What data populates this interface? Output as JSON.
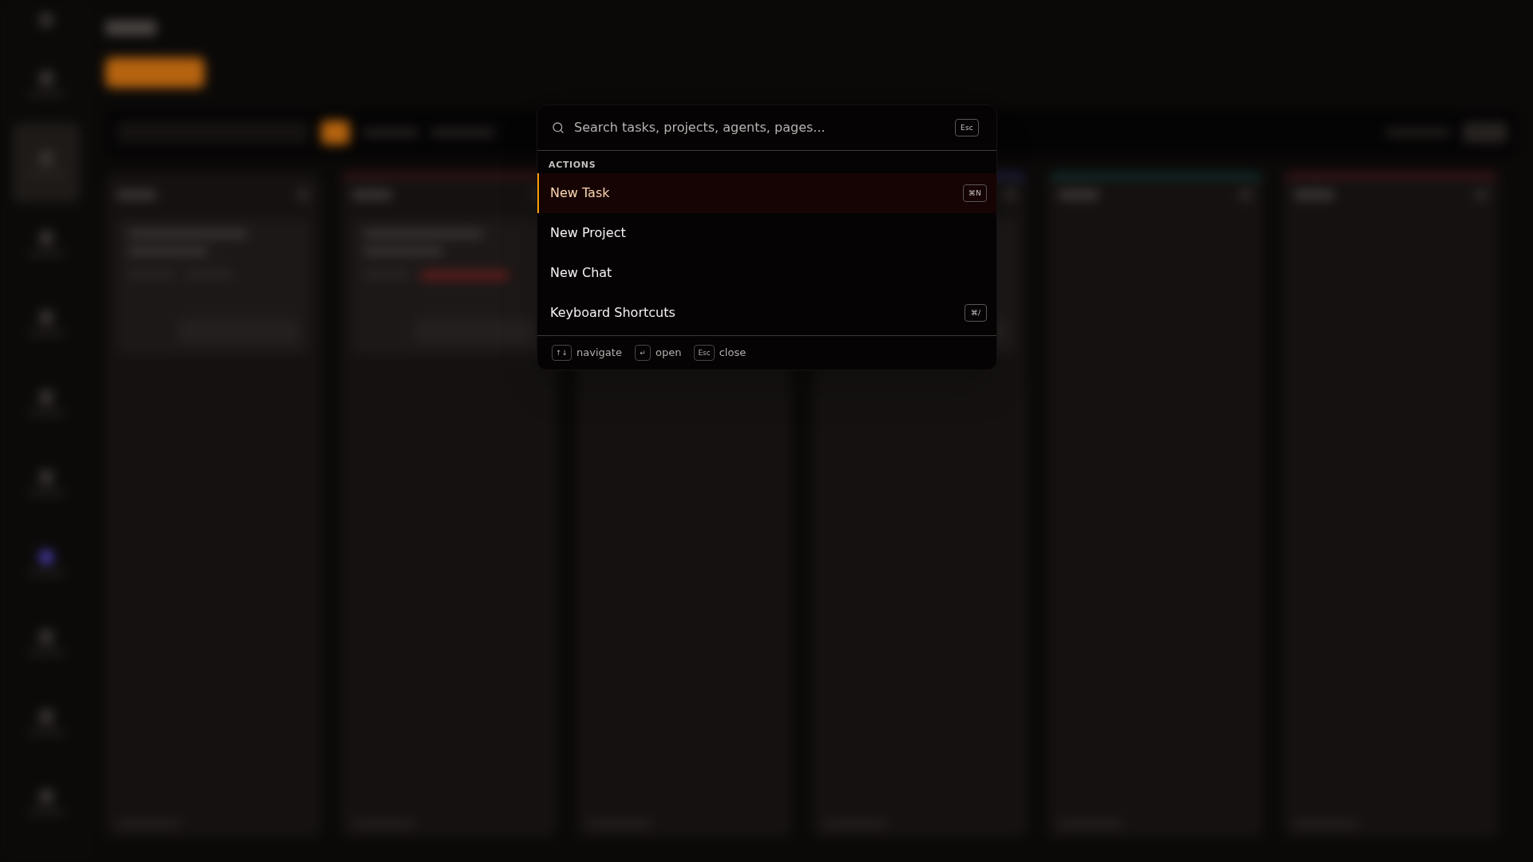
{
  "command_palette": {
    "search": {
      "placeholder": "Search tasks, projects, agents, pages...",
      "shortcut": "Esc"
    },
    "sections": [
      {
        "title": "ACTIONS",
        "items": [
          {
            "label": "New Task",
            "shortcut": "⌘N",
            "selected": true
          },
          {
            "label": "New Project",
            "selected": false
          },
          {
            "label": "New Chat",
            "selected": false
          },
          {
            "label": "Keyboard Shortcuts",
            "shortcut": "⌘/",
            "selected": false
          }
        ]
      }
    ],
    "footer_hints": [
      {
        "keys": "↑↓",
        "label": "navigate"
      },
      {
        "keys": "↵",
        "label": "open"
      },
      {
        "keys": "Esc",
        "label": "close"
      }
    ]
  }
}
